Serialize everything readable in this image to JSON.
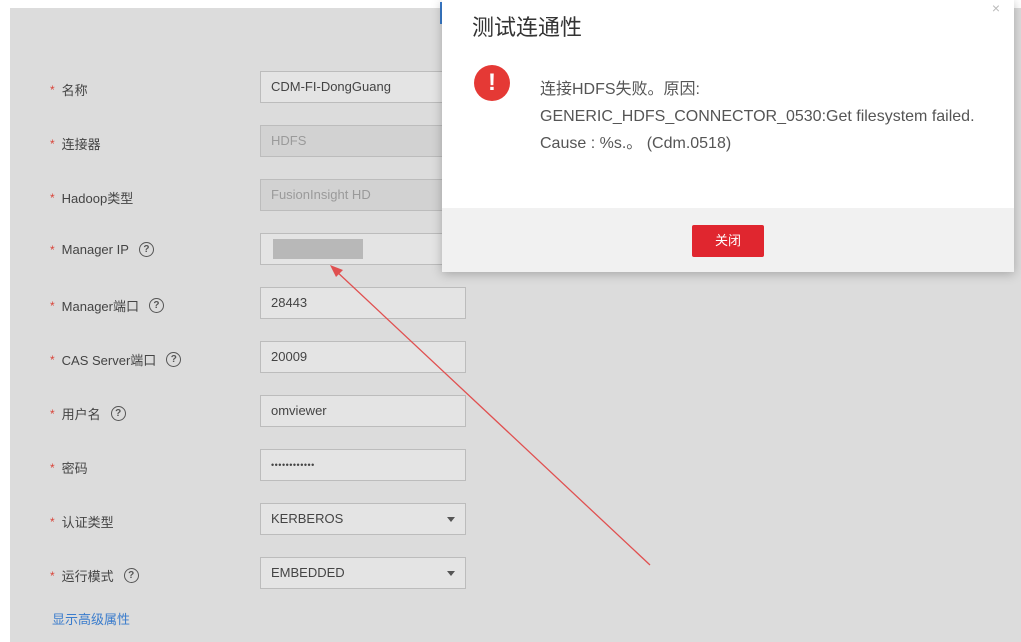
{
  "form": {
    "fields": [
      {
        "label": "名称",
        "value": "CDM-FI-DongGuang"
      },
      {
        "label": "连接器",
        "value": "HDFS"
      },
      {
        "label": "Hadoop类型",
        "value": "FusionInsight HD"
      },
      {
        "label": "Manager IP",
        "value": ""
      },
      {
        "label": "Manager端口",
        "value": "28443"
      },
      {
        "label": "CAS Server端口",
        "value": "20009"
      },
      {
        "label": "用户名",
        "value": "omviewer"
      },
      {
        "label": "密码",
        "value": "••••••••••••"
      },
      {
        "label": "认证类型",
        "value": "KERBEROS"
      },
      {
        "label": "运行模式",
        "value": "EMBEDDED"
      }
    ],
    "help_glyph": "?",
    "required_mark": "*",
    "advanced_link": "显示高级属性"
  },
  "dialog": {
    "title": "测试连通性",
    "close_glyph": "×",
    "icon_glyph": "!",
    "message": "连接HDFS失败。原因: GENERIC_HDFS_CONNECTOR_0530:Get filesystem failed. Cause : %s.。 (Cdm.0518)",
    "close_button": "关闭"
  },
  "colors": {
    "overlay": "#dcdcdc",
    "error": "#e53935",
    "button": "#e0262f",
    "link": "#3a7ccc",
    "annotation_arrow": "#e05050"
  }
}
